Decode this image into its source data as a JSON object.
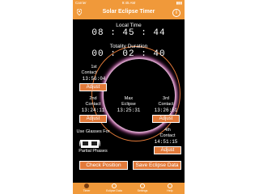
{
  "status": {
    "carrier": "Carrier",
    "time": "9:45 AM",
    "battery": "▮▮▮"
  },
  "nav": {
    "title": "Solar Eclipse Timer",
    "info_glyph": "i"
  },
  "local_time": {
    "label": "Local Time",
    "value": "08 : 45 : 44"
  },
  "totality": {
    "label": "Totality Duration",
    "value": "00 : 02 : 40"
  },
  "contacts": {
    "first": {
      "label_1": "1st",
      "label_2": "Contact",
      "time": "13:56:04",
      "button": "Adjust"
    },
    "second": {
      "label_1": "2nd",
      "label_2": "Contact",
      "time": "13:24:11",
      "button": "Adjust"
    },
    "max": {
      "label_1": "Max",
      "label_2": "Eclipse",
      "time": "13:25:31"
    },
    "third": {
      "label_1": "3rd",
      "label_2": "Contact",
      "time": "13:26:51",
      "button": "Adjust"
    },
    "fourth": {
      "label_1": "4th",
      "label_2": "Contact",
      "time": "14:51:15",
      "button": "Adjust"
    }
  },
  "glasses": {
    "line1": "Use Glasses For",
    "line2": "Partial Phases"
  },
  "actions": {
    "check_position": "Check Position",
    "save_data": "Save Eclipse Data"
  },
  "tabs": [
    {
      "label": "Timer"
    },
    {
      "label": "Eclipse Data"
    },
    {
      "label": "Settings"
    },
    {
      "label": "Help"
    }
  ],
  "colors": {
    "accent": "#f0993a",
    "button": "#e27a3a",
    "corona_glow": "#ff4fd0"
  }
}
